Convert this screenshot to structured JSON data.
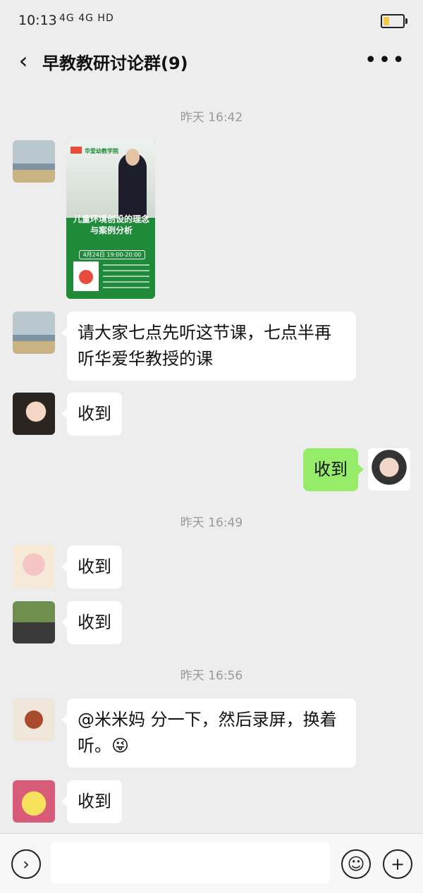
{
  "status": {
    "time": "10:13",
    "signal": "4G 4G HD",
    "battery_level_percent": 30
  },
  "header": {
    "title": "早教教研讨论群(9)"
  },
  "chat": {
    "timestamps": [
      "昨天 16:42",
      "昨天 16:49",
      "昨天 16:56"
    ],
    "poster": {
      "brand": "华爱幼教学院",
      "title": "儿童环境创设的理念与案例分析",
      "date": "4月24日 19:00-20:00"
    },
    "messages": [
      "请大家七点先听这节课，七点半再听华爱华教授的课",
      "收到",
      "收到",
      "收到",
      "收到",
      "@米米妈  分一下，然后录屏，换着听。😜",
      "收到"
    ]
  },
  "colors": {
    "background": "#ededed",
    "my_bubble": "#95ec69",
    "bubble": "#ffffff"
  },
  "icons": {
    "back": "chevron-left-icon",
    "more": "more-icon",
    "voice": "voice-icon",
    "emoji": "emoji-icon",
    "plus": "plus-icon"
  }
}
